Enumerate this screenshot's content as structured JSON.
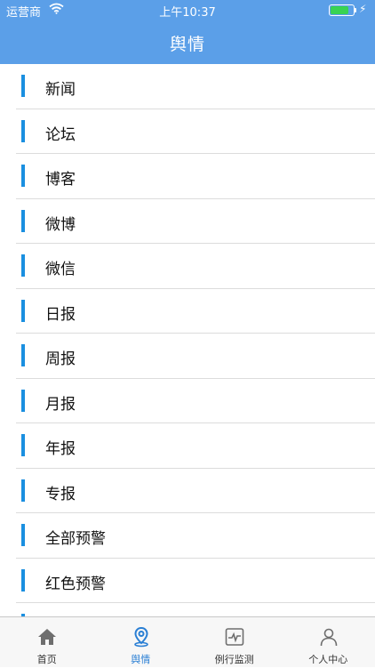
{
  "status_bar": {
    "carrier": "运营商",
    "time": "上午10:37"
  },
  "header": {
    "title": "舆情"
  },
  "list": {
    "items": [
      {
        "label": "新闻"
      },
      {
        "label": "论坛"
      },
      {
        "label": "博客"
      },
      {
        "label": "微博"
      },
      {
        "label": "微信"
      },
      {
        "label": "日报"
      },
      {
        "label": "周报"
      },
      {
        "label": "月报"
      },
      {
        "label": "年报"
      },
      {
        "label": "专报"
      },
      {
        "label": "全部预警"
      },
      {
        "label": "红色预警"
      }
    ]
  },
  "tabbar": {
    "tabs": [
      {
        "label": "首页",
        "icon": "home-icon"
      },
      {
        "label": "舆情",
        "icon": "location-pin-icon",
        "active": true
      },
      {
        "label": "例行监测",
        "icon": "monitor-pulse-icon"
      },
      {
        "label": "个人中心",
        "icon": "user-icon"
      }
    ]
  },
  "colors": {
    "accent": "#5b9fe8",
    "list_accent": "#1a8fe0",
    "active_tab": "#2a7fd4",
    "battery": "#39d353"
  }
}
